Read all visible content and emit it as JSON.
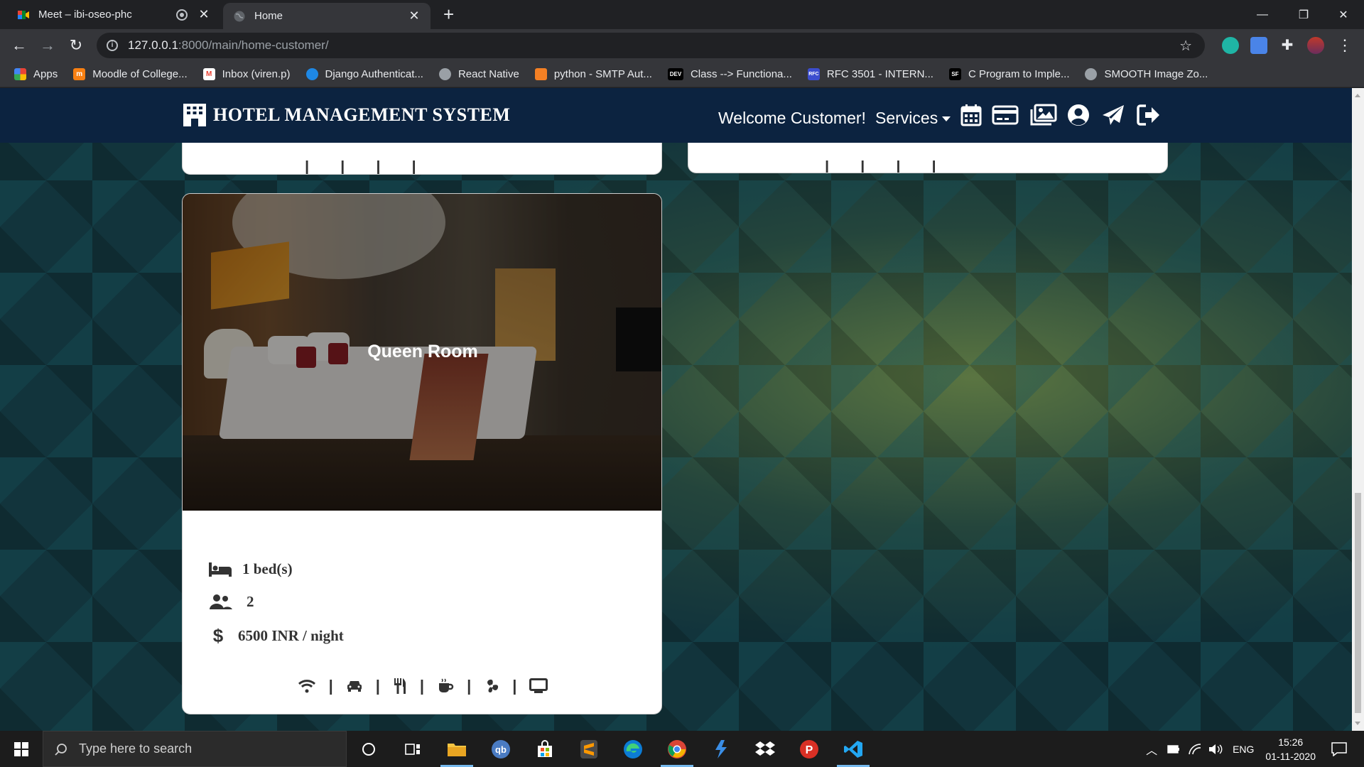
{
  "browser": {
    "tabs": [
      {
        "title": "Meet – ibi-oseo-phc",
        "active": false,
        "icon": "google-meet-icon"
      },
      {
        "title": "Home",
        "active": true,
        "icon": "globe-icon"
      }
    ],
    "url_host": "127.0.0.1",
    "url_path": ":8000/main/home-customer/",
    "bookmarks": [
      {
        "label": "Apps",
        "icon": "apps-grid-icon"
      },
      {
        "label": "Moodle of College...",
        "icon": "moodle-icon"
      },
      {
        "label": "Inbox (viren.p)",
        "icon": "gmail-icon"
      },
      {
        "label": "Django Authenticat...",
        "icon": "django-icon"
      },
      {
        "label": "React Native",
        "icon": "globe-icon"
      },
      {
        "label": "python - SMTP Aut...",
        "icon": "stackoverflow-icon"
      },
      {
        "label": "Class --> Functiona...",
        "icon": "dev-icon"
      },
      {
        "label": "RFC 3501 - INTERN...",
        "icon": "rfc-icon"
      },
      {
        "label": "C Program to Imple...",
        "icon": "sf-icon"
      },
      {
        "label": "SMOOTH Image Zo...",
        "icon": "globe-icon"
      }
    ]
  },
  "site": {
    "brand": "HOTEL MANAGEMENT SYSTEM",
    "welcome": "Welcome Customer!",
    "services": "Services",
    "nav_icons": [
      "calendar-icon",
      "credit-card-icon",
      "images-icon",
      "user-circle-icon",
      "paper-plane-icon",
      "sign-out-icon"
    ]
  },
  "room": {
    "name": "Queen Room",
    "beds": "1 bed(s)",
    "guests": "2",
    "price": "6500 INR / night",
    "amenities": [
      "wifi-icon",
      "car-icon",
      "utensils-icon",
      "coffee-icon",
      "fan-icon",
      "tv-icon"
    ]
  },
  "taskbar": {
    "search_placeholder": "Type here to search",
    "language": "ENG",
    "time": "15:26",
    "date": "01-11-2020"
  },
  "colors": {
    "navbar": "#0c2340",
    "chrome_dark": "#202124",
    "chrome_toolbar": "#35363a"
  }
}
